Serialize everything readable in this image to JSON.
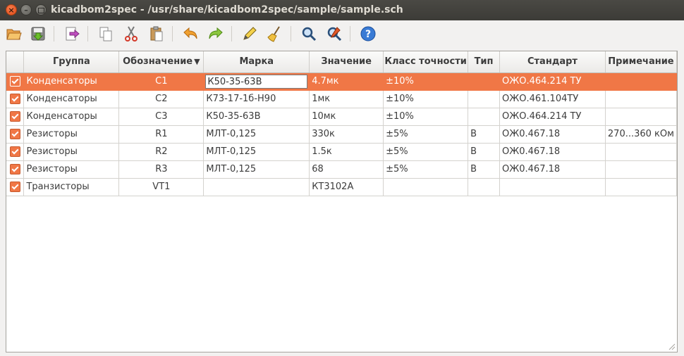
{
  "window": {
    "title": "kicadbom2spec - /usr/share/kicadbom2spec/sample/sample.sch",
    "close_glyph": "×",
    "minimize_glyph": "–"
  },
  "toolbar": {
    "buttons": [
      {
        "name": "open-icon"
      },
      {
        "name": "save-icon"
      },
      {
        "name": "export-icon"
      },
      {
        "name": "copy-icon"
      },
      {
        "name": "cut-icon"
      },
      {
        "name": "paste-icon"
      },
      {
        "name": "undo-icon"
      },
      {
        "name": "redo-icon"
      },
      {
        "name": "edit-icon"
      },
      {
        "name": "clear-icon"
      },
      {
        "name": "find-icon"
      },
      {
        "name": "replace-icon"
      },
      {
        "name": "help-icon"
      }
    ]
  },
  "table": {
    "headers": {
      "check": "",
      "group": "Группа",
      "ref": "Обозначение",
      "ref_sort": "▼",
      "mark": "Марка",
      "value": "Значение",
      "accuracy": "Класс точности",
      "type": "Тип",
      "standard": "Стандарт",
      "note": "Примечание"
    },
    "rows": [
      {
        "group": "Конденсаторы",
        "ref": "C1",
        "mark": "К50-35-63В",
        "value": "4.7мк",
        "accuracy": "±10%",
        "type": "",
        "standard": "ОЖО.464.214 ТУ",
        "note": ""
      },
      {
        "group": "Конденсаторы",
        "ref": "C2",
        "mark": "К73-17-1б-Н90",
        "value": "1мк",
        "accuracy": "±10%",
        "type": "",
        "standard": "ОЖО.461.104ТУ",
        "note": ""
      },
      {
        "group": "Конденсаторы",
        "ref": "C3",
        "mark": "К50-35-63В",
        "value": "10мк",
        "accuracy": "±10%",
        "type": "",
        "standard": "ОЖО.464.214 ТУ",
        "note": ""
      },
      {
        "group": "Резисторы",
        "ref": "R1",
        "mark": "МЛТ-0,125",
        "value": "330к",
        "accuracy": "±5%",
        "type": "В",
        "standard": "ОЖ0.467.18",
        "note": "270...360 кОм"
      },
      {
        "group": "Резисторы",
        "ref": "R2",
        "mark": "МЛТ-0,125",
        "value": "1.5к",
        "accuracy": "±5%",
        "type": "В",
        "standard": "ОЖ0.467.18",
        "note": ""
      },
      {
        "group": "Резисторы",
        "ref": "R3",
        "mark": "МЛТ-0,125",
        "value": "68",
        "accuracy": "±5%",
        "type": "В",
        "standard": "ОЖ0.467.18",
        "note": ""
      },
      {
        "group": "Транзисторы",
        "ref": "VT1",
        "mark": "",
        "value": "КТ3102А",
        "accuracy": "",
        "type": "",
        "standard": "",
        "note": ""
      }
    ]
  },
  "colors": {
    "accent": "#f07746",
    "titlebar": "#3c3b37"
  }
}
